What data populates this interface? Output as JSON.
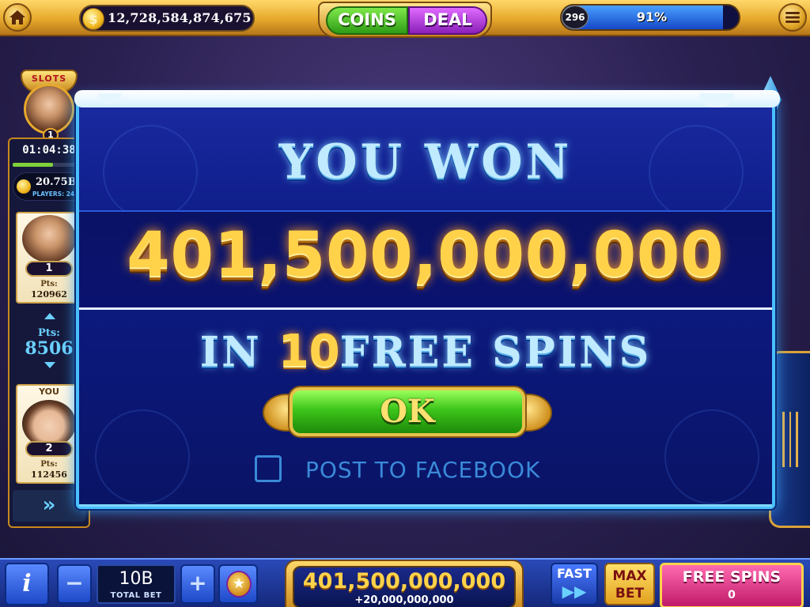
{
  "topbar": {
    "balance": "12,728,584,874,675",
    "coins_label": "COINS",
    "deal_label": "DEAL",
    "level": "296",
    "level_progress_percent": 91,
    "level_percent_text": "91%",
    "icons": {
      "home": "home-icon",
      "menu": "menu-icon",
      "coin": "coin-icon"
    }
  },
  "tournament": {
    "trophy_label": "SLOTS",
    "leader_rank_badge": "1",
    "timer": "01:04:38",
    "timer_progress_fraction": 0.55,
    "prize": "20.75B",
    "players": "PLAYERS: 24",
    "leader": {
      "rank": "1",
      "pts_label": "Pts:",
      "pts": "120962"
    },
    "gap": {
      "label": "Pts:",
      "value": "8506"
    },
    "you": {
      "label": "YOU",
      "rank": "2",
      "pts_label": "Pts:",
      "pts": "112456"
    },
    "expand_icon": "double-chevron-right-icon"
  },
  "modal": {
    "title": "YOU WON",
    "amount": "401,500,000,000",
    "spins_prefix": "IN ",
    "spins_count": "10",
    "spins_suffix": "FREE SPINS",
    "ok_label": "OK",
    "facebook_checked": false,
    "facebook_label": "POST TO FACEBOOK"
  },
  "bottombar": {
    "info_label": "i",
    "minus_label": "−",
    "plus_label": "+",
    "bet_value": "10B",
    "bet_label": "TOTAL BET",
    "win_total": "401,500,000,000",
    "win_delta": "+20,000,000,000",
    "fast_label": "FAST",
    "fast_arrows": "▶▶",
    "maxbet_label": "MAX BET",
    "freespins_label": "FREE SPINS",
    "freespins_count": "0"
  },
  "colors": {
    "gold": "#ffd24a",
    "ice": "#bfeaff",
    "modal_bg": "#0e1d88",
    "ok_green": "#3cc41a",
    "freespins_pink": "#c01a6a"
  }
}
